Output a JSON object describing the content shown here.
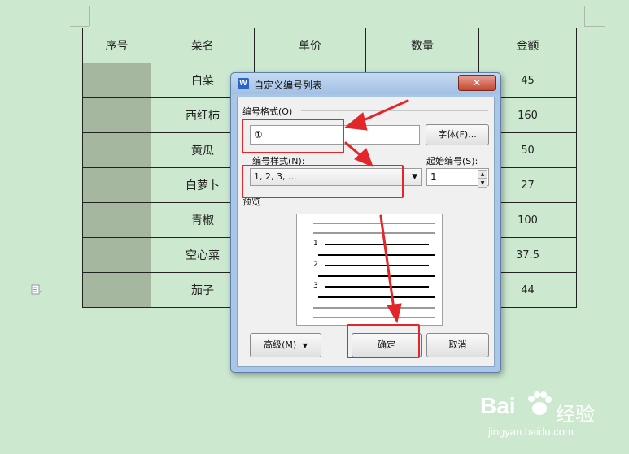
{
  "table": {
    "headers": [
      "序号",
      "菜名",
      "单价",
      "数量",
      "金额"
    ],
    "rows": [
      {
        "name": "白菜",
        "amount": "45"
      },
      {
        "name": "西红柿",
        "amount": "160"
      },
      {
        "name": "黄瓜",
        "amount": "50"
      },
      {
        "name": "白萝卜",
        "amount": "27"
      },
      {
        "name": "青椒",
        "amount": "100"
      },
      {
        "name": "空心菜",
        "amount": "37.5"
      },
      {
        "name": "茄子",
        "amount": "44"
      }
    ]
  },
  "dialog": {
    "app_icon": "W",
    "title": "自定义编号列表",
    "close_glyph": "✕",
    "format_label": "编号格式(O)",
    "format_value": "①",
    "font_button": "字体(F)...",
    "style_label": "编号样式(N):",
    "style_value": "1, 2, 3, ...",
    "start_label": "起始编号(S):",
    "start_value": "1",
    "preview_label": "预览",
    "preview_numbers": [
      "1",
      "2",
      "3"
    ],
    "advanced_button": "高级(M)",
    "ok_button": "确定",
    "cancel_button": "取消"
  },
  "watermark": {
    "logo": "Bai",
    "logo_cn": "经验",
    "url": "jingyan.baidu.com"
  },
  "colors": {
    "background": "#cce8cf",
    "annotation_red": "#e3262a",
    "index_cell": "#a5b79f"
  }
}
